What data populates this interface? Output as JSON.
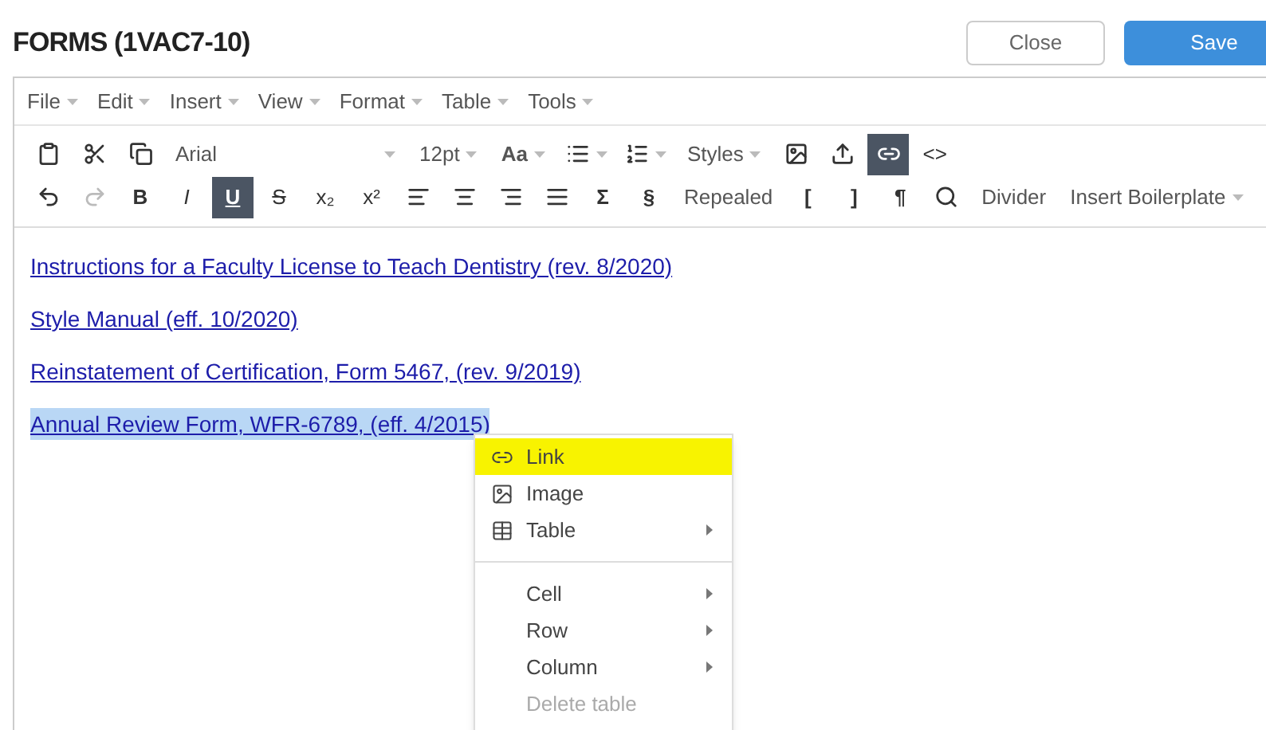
{
  "title": "FORMS (1VAC7-10)",
  "buttons": [
    {
      "label": "Close",
      "kind": "secondary"
    },
    {
      "label": "Save",
      "kind": "primary"
    }
  ],
  "menubar": [
    "File",
    "Edit",
    "Insert",
    "View",
    "Format",
    "Table",
    "Tools"
  ],
  "toolbar_rows": [
    [
      {
        "kind": "paste",
        "active": false
      },
      {
        "kind": "cut",
        "active": false
      },
      {
        "kind": "copy",
        "active": false
      },
      {
        "kind": "font",
        "label": "Arial"
      },
      {
        "kind": "select",
        "label": "12pt"
      },
      {
        "kind": "case",
        "label": "Aa"
      },
      {
        "kind": "bullets",
        "active": false
      },
      {
        "kind": "numbers",
        "active": false
      },
      {
        "kind": "select",
        "label": "Styles"
      },
      {
        "kind": "image",
        "active": false
      },
      {
        "kind": "upload",
        "active": false
      },
      {
        "kind": "link",
        "active": true
      },
      {
        "kind": "glyph",
        "label": "<>",
        "active": false
      }
    ],
    [
      {
        "kind": "undo",
        "active": false,
        "disabled": false
      },
      {
        "kind": "redo",
        "active": false,
        "disabled": true
      },
      {
        "kind": "bold",
        "label": "B",
        "active": false
      },
      {
        "kind": "italic",
        "label": "I",
        "active": false
      },
      {
        "kind": "underline",
        "label": "U",
        "active": true
      },
      {
        "kind": "strike",
        "label": "S",
        "active": false
      },
      {
        "kind": "glyph",
        "label": "x₂",
        "active": false
      },
      {
        "kind": "glyph",
        "label": "x²",
        "active": false
      },
      {
        "kind": "align-left",
        "active": false
      },
      {
        "kind": "align-center",
        "active": false
      },
      {
        "kind": "align-right",
        "active": false
      },
      {
        "kind": "align-justify",
        "active": false
      },
      {
        "kind": "symbol",
        "label": "Σ",
        "active": false
      },
      {
        "kind": "symbol",
        "label": "§",
        "active": false
      },
      {
        "kind": "glyph",
        "label": "Repealed",
        "active": false
      },
      {
        "kind": "symbol",
        "label": "[",
        "active": false
      },
      {
        "kind": "symbol",
        "label": "]",
        "active": false
      },
      {
        "kind": "symbol",
        "label": "¶",
        "active": false
      },
      {
        "kind": "lookup",
        "active": false
      },
      {
        "kind": "glyph",
        "label": "Divider",
        "active": false
      },
      {
        "kind": "select",
        "label": "Insert Boilerplate"
      }
    ]
  ],
  "links": [
    {
      "text": "Instructions for a Faculty License to Teach Dentistry (rev. 8/2020)",
      "selected": false
    },
    {
      "text": "Style Manual (eff. 10/2020)",
      "selected": false
    },
    {
      "text": "Reinstatement of Certification, Form 5467, (rev. 9/2019)",
      "selected": false
    },
    {
      "text": "Annual Review Form, WFR-6789, (eff. 4/2015)",
      "selected": true
    }
  ],
  "context_menu": [
    {
      "label": "Link",
      "kind": "link",
      "highlighted": true,
      "disabled": false,
      "submenu": false
    },
    {
      "label": "Image",
      "kind": "image",
      "highlighted": false,
      "disabled": false,
      "submenu": false
    },
    {
      "label": "Table",
      "kind": "table",
      "highlighted": false,
      "disabled": false,
      "submenu": true
    },
    {
      "kind": "separator"
    },
    {
      "label": "Cell",
      "kind": "plain",
      "highlighted": false,
      "disabled": false,
      "submenu": true
    },
    {
      "label": "Row",
      "kind": "plain",
      "highlighted": false,
      "disabled": false,
      "submenu": true
    },
    {
      "label": "Column",
      "kind": "plain",
      "highlighted": false,
      "disabled": false,
      "submenu": true
    },
    {
      "label": "Delete table",
      "kind": "plain",
      "highlighted": false,
      "disabled": true,
      "submenu": false
    }
  ]
}
